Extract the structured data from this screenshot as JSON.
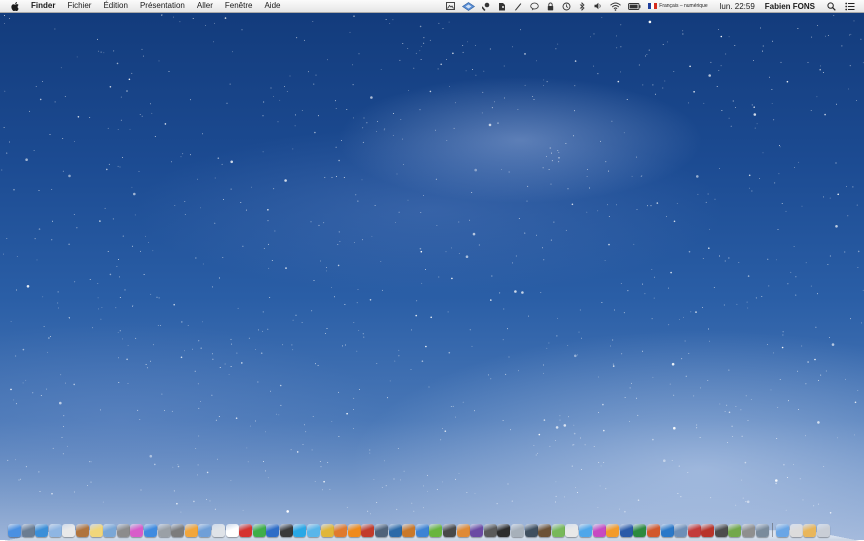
{
  "menubar": {
    "app_name": "Finder",
    "menus": [
      "Fichier",
      "Édition",
      "Présentation",
      "Aller",
      "Fenêtre",
      "Aide"
    ],
    "status_icons": [
      "image-capture-icon",
      "dropbox-icon",
      "wrench-icon",
      "evernote-icon",
      "pen-icon",
      "speech-bubble-icon",
      "lock-icon",
      "time-machine-icon",
      "bluetooth-icon",
      "volume-icon",
      "wifi-icon",
      "battery-icon"
    ],
    "input_source": "Français – numérique",
    "clock": "lun. 22:59",
    "user": "Fabien FONS",
    "spotlight_icon": "spotlight-search-icon",
    "notification_icon": "notification-center-icon"
  },
  "colors": {
    "sky_top": "#123a7a",
    "sky_bottom": "#9db4d8",
    "menubar": "#ececec"
  },
  "dock": {
    "apps": [
      {
        "icon": "finder-icon",
        "color": "#4a90e2"
      },
      {
        "icon": "launchpad-icon",
        "color": "#6b7d92"
      },
      {
        "icon": "safari-icon",
        "color": "#3b8fd8"
      },
      {
        "icon": "mail-icon",
        "color": "#8fb6e3"
      },
      {
        "icon": "calendar-icon",
        "color": "#e9e9e9"
      },
      {
        "icon": "contacts-icon",
        "color": "#b0743d"
      },
      {
        "icon": "notes-icon",
        "color": "#f1d67a"
      },
      {
        "icon": "photos-icon",
        "color": "#7aa7d6"
      },
      {
        "icon": "preview-icon",
        "color": "#8c8c8c"
      },
      {
        "icon": "itunes-icon",
        "color": "#d85cc9"
      },
      {
        "icon": "app-store-icon",
        "color": "#3f8be0"
      },
      {
        "icon": "facetime-icon",
        "color": "#9aa0a6"
      },
      {
        "icon": "system-preferences-icon",
        "color": "#7c7c7c"
      },
      {
        "icon": "pages-icon",
        "color": "#f2a63b"
      },
      {
        "icon": "keynote-icon",
        "color": "#6f9fd8"
      },
      {
        "icon": "numbers-icon",
        "color": "#dfe3e8"
      },
      {
        "icon": "textedit-icon",
        "color": "#ffffff"
      },
      {
        "icon": "dictionary-icon",
        "color": "#d5332f"
      },
      {
        "icon": "evernote-app-icon",
        "color": "#3fae49"
      },
      {
        "icon": "xcode-icon",
        "color": "#2e6dc7"
      },
      {
        "icon": "terminal-icon",
        "color": "#3a3a3a"
      },
      {
        "icon": "skype-icon",
        "color": "#2aa8e6"
      },
      {
        "icon": "twitter-icon",
        "color": "#59b6ea"
      },
      {
        "icon": "chrome-icon",
        "color": "#e0b63a"
      },
      {
        "icon": "firefox-icon",
        "color": "#e07a2e"
      },
      {
        "icon": "vlc-icon",
        "color": "#f08a1a"
      },
      {
        "icon": "transmission-icon",
        "color": "#c23b2b"
      },
      {
        "icon": "steam-icon",
        "color": "#50637a"
      },
      {
        "icon": "photoshop-icon",
        "color": "#2b6aa8"
      },
      {
        "icon": "illustrator-icon",
        "color": "#c9782a"
      },
      {
        "icon": "dropbox-app-icon",
        "color": "#3d83d4"
      },
      {
        "icon": "spotify-icon",
        "color": "#68b53e"
      },
      {
        "icon": "aperture-icon",
        "color": "#494949"
      },
      {
        "icon": "garageband-icon",
        "color": "#e08a35"
      },
      {
        "icon": "imovie-icon",
        "color": "#6b4aa3"
      },
      {
        "icon": "calculator-icon",
        "color": "#5a5a5a"
      },
      {
        "icon": "activity-monitor-icon",
        "color": "#2c2c2c"
      },
      {
        "icon": "disk-utility-icon",
        "color": "#a7b0ba"
      },
      {
        "icon": "console-icon",
        "color": "#3f4f5f"
      },
      {
        "icon": "chess-icon",
        "color": "#6c5236"
      },
      {
        "icon": "maps-icon",
        "color": "#78b85a"
      },
      {
        "icon": "reminders-icon",
        "color": "#e8e8e8"
      },
      {
        "icon": "messages-icon",
        "color": "#4fa7ea"
      },
      {
        "icon": "game-center-icon",
        "color": "#c74ac1"
      },
      {
        "icon": "ibooks-icon",
        "color": "#f39b2b"
      },
      {
        "icon": "word-icon",
        "color": "#2a5aa8"
      },
      {
        "icon": "excel-icon",
        "color": "#2d8a3e"
      },
      {
        "icon": "powerpoint-icon",
        "color": "#d2582c"
      },
      {
        "icon": "outlook-icon",
        "color": "#2a78c8"
      },
      {
        "icon": "vmware-icon",
        "color": "#6e8fb7"
      },
      {
        "icon": "parallels-icon",
        "color": "#c33b3b"
      },
      {
        "icon": "filezilla-icon",
        "color": "#b8342a"
      },
      {
        "icon": "sublime-text-icon",
        "color": "#4d4d4d"
      },
      {
        "icon": "coda-icon",
        "color": "#73a84a"
      },
      {
        "icon": "keychain-icon",
        "color": "#8f8f8f"
      },
      {
        "icon": "utilities-icon",
        "color": "#7a8b9c"
      }
    ],
    "stacks": [
      {
        "icon": "applications-folder-icon",
        "color": "#6aa6e6"
      },
      {
        "icon": "documents-stack-icon",
        "color": "#dcdcdc"
      },
      {
        "icon": "downloads-stack-icon",
        "color": "#e9b65a"
      },
      {
        "icon": "trash-icon",
        "color": "#c9ced6"
      }
    ]
  }
}
